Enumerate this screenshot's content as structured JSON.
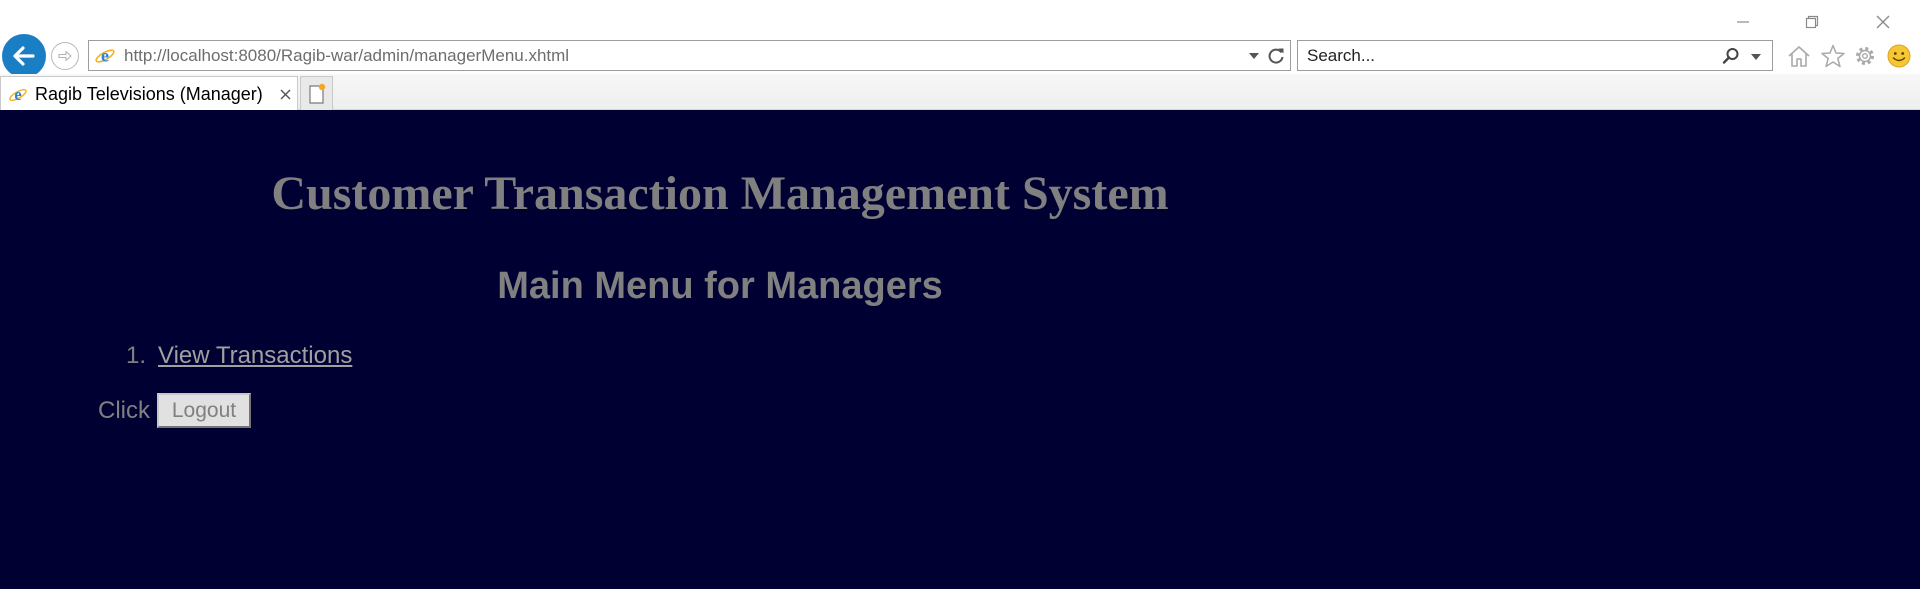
{
  "browser": {
    "address_url": "http://localhost:8080/Ragib-war/admin/managerMenu.xhtml",
    "search_placeholder": "Search...",
    "tab_title": "Ragib Televisions (Manager)",
    "accent_color": "#1a7ec4"
  },
  "page": {
    "main_title": "Customer Transaction Management System",
    "sub_title": "Main Menu for Managers",
    "menu_items": [
      {
        "number": "1.",
        "label": "View Transactions"
      }
    ],
    "click_label": "Click",
    "logout_label": "Logout",
    "background_color": "#000033",
    "text_color": "#808080"
  }
}
